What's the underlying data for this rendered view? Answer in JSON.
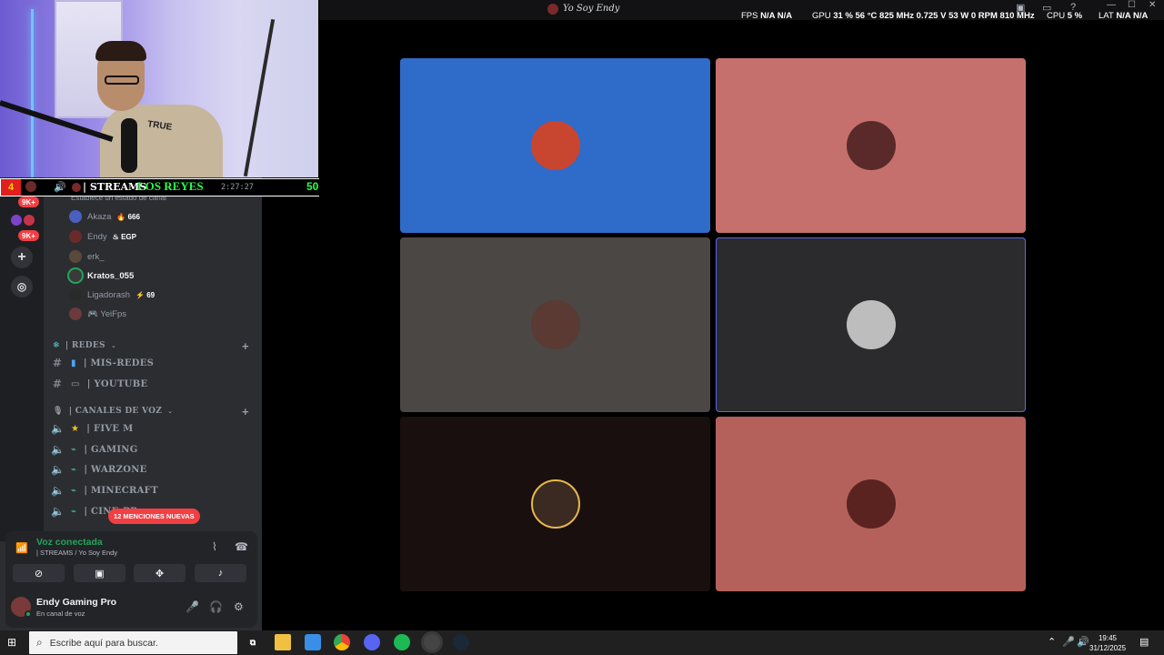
{
  "webcam": {
    "shirt_text": "TRUE"
  },
  "ticker": {
    "count": "4",
    "channel": "| STREAMS",
    "overlay": "LOS REYES",
    "time": "2:27:27",
    "score": "50"
  },
  "guild_badges": [
    "9K+",
    "9K+"
  ],
  "channel_list": {
    "status_line": "Establece un estado de canal",
    "members": [
      {
        "name": "Akaza",
        "tag": "666",
        "active": false
      },
      {
        "name": "Endy",
        "tag": "EGP",
        "active": false
      },
      {
        "name": "erk_",
        "tag": "",
        "active": false
      },
      {
        "name": "Kratos_055",
        "tag": "",
        "active": true
      },
      {
        "name": "Ligadorash",
        "tag": "69",
        "active": false
      },
      {
        "name": "YeiFps",
        "tag": "",
        "active": false
      }
    ],
    "categories": [
      {
        "label": "| REDES"
      },
      {
        "label": "| CANALES DE VOZ"
      }
    ],
    "text_channels": [
      "| MIS-REDES",
      "| YOUTUBE"
    ],
    "voice_channels": [
      "| FIVE M",
      "| GAMING",
      "| WARZONE",
      "| MINECRAFT",
      "| CINE-PR"
    ]
  },
  "mentions_badge": "12 MENCIONES NUEVAS",
  "voice_panel": {
    "status": "Voz conectada",
    "channel": "| STREAMS / Yo Soy Endy",
    "user_name": "Endy Gaming Pro",
    "user_status": "En canal de voz"
  },
  "stream": {
    "title": "Yo Soy Endy",
    "osd": {
      "fps_label": "FPS",
      "fps_value": "N/A N/A",
      "gpu_label": "GPU",
      "gpu_value": "31 % 56 °C 825 MHz 0.725 V 53 W 0 RPM 810 MHz",
      "cpu_label": "CPU",
      "cpu_value": "5 %",
      "lat_label": "LAT",
      "lat_value": "N/A N/A"
    },
    "tiles": [
      {
        "color": "#2f6bc9",
        "avatar": "#c8452f"
      },
      {
        "color": "#c5706d",
        "avatar": "#5a2a2a"
      },
      {
        "color": "#4a4744",
        "avatar": "#5a3a32"
      },
      {
        "color": "#2b2a2c",
        "avatar": "#bdbdbd"
      },
      {
        "color": "#1a0f0f",
        "avatar": "#3a2a22"
      },
      {
        "color": "#b5615b",
        "avatar": "#5a2320"
      }
    ]
  },
  "taskbar": {
    "search_placeholder": "Escribe aquí para buscar.",
    "time": "19:45",
    "date": "31/12/2025"
  }
}
